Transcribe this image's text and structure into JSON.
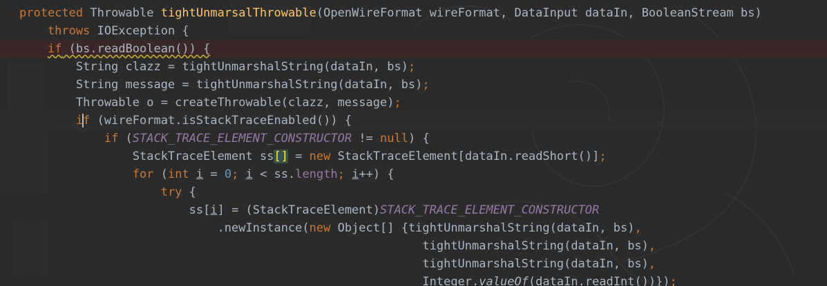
{
  "editor": {
    "colors": {
      "background": "#2b2b2b",
      "keyword": "#cc7832",
      "method_declaration": "#ffc66d",
      "text": "#a9b7c6",
      "constant": "#9876aa",
      "number": "#6897bb",
      "error_line_highlight": "#3b2727"
    },
    "lines": [
      {
        "highlight": false,
        "tokens": [
          {
            "text": "protected ",
            "style": "kw"
          },
          {
            "text": "Throwable ",
            "style": "plain"
          },
          {
            "text": "tightUnmarsalThrowable",
            "style": "fn"
          },
          {
            "text": "(OpenWireFormat wireFormat, DataInput dataIn, BooleanStream bs)",
            "style": "plain"
          }
        ]
      },
      {
        "highlight": false,
        "tokens": [
          {
            "text": "    throws ",
            "style": "kw"
          },
          {
            "text": "IOException {",
            "style": "plain"
          }
        ]
      },
      {
        "highlight": true,
        "tokens": [
          {
            "text": "    ",
            "style": "plain"
          },
          {
            "text": "if",
            "style": "kw warn"
          },
          {
            "text": " (bs.readBoolean()) {",
            "style": "plain warn"
          }
        ]
      },
      {
        "highlight": false,
        "tokens": [
          {
            "text": "        String clazz = tightUnmarshalString(dataIn, bs)",
            "style": "plain"
          },
          {
            "text": ";",
            "style": "kw"
          }
        ]
      },
      {
        "highlight": false,
        "tokens": [
          {
            "text": "        String message = tightUnmarshalString(dataIn, bs)",
            "style": "plain"
          },
          {
            "text": ";",
            "style": "kw"
          }
        ]
      },
      {
        "highlight": false,
        "tokens": [
          {
            "text": "        Throwable o = createThrowable(clazz, message)",
            "style": "plain"
          },
          {
            "text": ";",
            "style": "kw"
          }
        ]
      },
      {
        "highlight": false,
        "caret_line": true,
        "tokens": [
          {
            "text": "        ",
            "style": "plain"
          },
          {
            "text": "i",
            "style": "kw"
          },
          {
            "caret": true
          },
          {
            "text": "f",
            "style": "kw"
          },
          {
            "text": " (wireFormat.isStackTraceEnabled()) {",
            "style": "plain"
          }
        ]
      },
      {
        "highlight": false,
        "tokens": [
          {
            "text": "            ",
            "style": "plain"
          },
          {
            "text": "if",
            "style": "kw"
          },
          {
            "text": " (",
            "style": "plain"
          },
          {
            "text": "STACK_TRACE_ELEMENT_CONSTRUCTOR",
            "style": "const"
          },
          {
            "text": " != ",
            "style": "plain"
          },
          {
            "text": "null",
            "style": "kw"
          },
          {
            "text": ") {",
            "style": "plain"
          }
        ]
      },
      {
        "highlight": false,
        "tokens": [
          {
            "text": "                StackTraceElement ss",
            "style": "plain"
          },
          {
            "text": "[]",
            "style": "plain bracket-match"
          },
          {
            "text": " = ",
            "style": "plain"
          },
          {
            "text": "new ",
            "style": "kw"
          },
          {
            "text": "StackTraceElement[dataIn.readShort()]",
            "style": "plain"
          },
          {
            "text": ";",
            "style": "kw"
          }
        ]
      },
      {
        "highlight": false,
        "tokens": [
          {
            "text": "                ",
            "style": "plain"
          },
          {
            "text": "for",
            "style": "kw"
          },
          {
            "text": " (",
            "style": "plain"
          },
          {
            "text": "int ",
            "style": "kw"
          },
          {
            "text": "i",
            "style": "plain u"
          },
          {
            "text": " = ",
            "style": "plain"
          },
          {
            "text": "0",
            "style": "num"
          },
          {
            "text": "; ",
            "style": "kw"
          },
          {
            "text": "i",
            "style": "plain u"
          },
          {
            "text": " < ss.",
            "style": "plain"
          },
          {
            "text": "length",
            "style": "field"
          },
          {
            "text": "; ",
            "style": "kw"
          },
          {
            "text": "i",
            "style": "plain u"
          },
          {
            "text": "++) {",
            "style": "plain"
          }
        ]
      },
      {
        "highlight": false,
        "tokens": [
          {
            "text": "                    ",
            "style": "plain"
          },
          {
            "text": "try",
            "style": "kw"
          },
          {
            "text": " {",
            "style": "plain"
          }
        ]
      },
      {
        "highlight": false,
        "tokens": [
          {
            "text": "                        ss[",
            "style": "plain"
          },
          {
            "text": "i",
            "style": "plain u"
          },
          {
            "text": "] = (StackTraceElement)",
            "style": "plain"
          },
          {
            "text": "STACK_TRACE_ELEMENT_CONSTRUCTOR",
            "style": "const"
          }
        ]
      },
      {
        "highlight": false,
        "tokens": [
          {
            "text": "                            .newInstance(",
            "style": "plain"
          },
          {
            "text": "new ",
            "style": "kw"
          },
          {
            "text": "Object[] {tightUnmarshalString(dataIn, bs)",
            "style": "plain"
          },
          {
            "text": ",",
            "style": "kw"
          }
        ]
      },
      {
        "highlight": false,
        "tokens": [
          {
            "text": "                                                         tightUnmarshalString(dataIn, bs)",
            "style": "plain"
          },
          {
            "text": ",",
            "style": "kw"
          }
        ]
      },
      {
        "highlight": false,
        "tokens": [
          {
            "text": "                                                         tightUnmarshalString(dataIn, bs)",
            "style": "plain"
          },
          {
            "text": ",",
            "style": "kw"
          }
        ]
      },
      {
        "highlight": false,
        "tokens": [
          {
            "text": "                                                         Integer.",
            "style": "plain"
          },
          {
            "text": "valueOf",
            "style": "static-call"
          },
          {
            "text": "(dataIn.readInt())})",
            "style": "plain"
          },
          {
            "text": ";",
            "style": "kw"
          }
        ]
      }
    ]
  }
}
